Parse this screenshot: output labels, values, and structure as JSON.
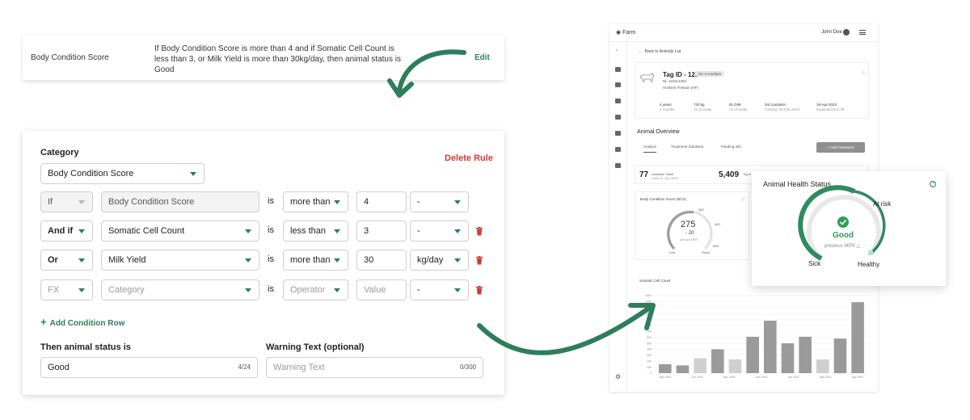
{
  "summary_rule": {
    "label": "Body Condition Score",
    "text": "If Body Condition Score is more than 4 and if Somatic Cell Count is less than 3, or Milk Yield is more than 30kg/day, then animal status is Good",
    "edit_label": "Edit"
  },
  "editor": {
    "category_label": "Category",
    "category_value": "Body Condition Score",
    "delete_label": "Delete Rule",
    "is_label": "is",
    "rows": [
      {
        "connector": "If",
        "field": "Body Condition Score",
        "operator": "more than",
        "value": "4",
        "unit": "-"
      },
      {
        "connector": "And if",
        "field": "Somatic Cell Count",
        "operator": "less than",
        "value": "3",
        "unit": "-"
      },
      {
        "connector": "Or",
        "field": "Milk Yield",
        "operator": "more than",
        "value": "30",
        "unit": "kg/day"
      },
      {
        "connector": "FX",
        "field": "Category",
        "operator": "Operator",
        "value": "Value",
        "unit": "-"
      }
    ],
    "add_condition_label": "Add Condition Row",
    "status_label": "Then animal status is",
    "status_value": "Good",
    "status_count": "4/24",
    "warning_label": "Warning Text (optional)",
    "warning_placeholder": "Warning Text",
    "warning_count": "0/300"
  },
  "dashboard": {
    "logo": "Farm",
    "user": "John Doe",
    "avatar_initial": "C",
    "back_link": "Back to Animals List",
    "tag_title": "Tag ID - 1234",
    "tag_badge": "DC-2-medium",
    "tag_number": "NL 123114284",
    "breed": "Holstein Friesian (HF)",
    "stats": [
      {
        "top": "4 years",
        "bottom": "2 months"
      },
      {
        "top": "720 kg",
        "bottom": "As of today"
      },
      {
        "top": "91 DIM",
        "bottom": "As of today"
      },
      {
        "top": "3rd Lactation",
        "bottom": "Calving: 09-Feb-2023"
      },
      {
        "top": "18-Apr-2023",
        "bottom": "Expected Dry Off"
      }
    ],
    "overview_title": "Animal Overview",
    "tabs": [
      "Analyze",
      "Treatment Solutions",
      "Feeding Info"
    ],
    "add_treatment": "+ Add Treatment",
    "kpi1_value": "77",
    "kpi1_label": "Lactation Value",
    "kpi1_sub": "Units 01-Jan-2023",
    "kpi2_value": "5,409",
    "kpi2_label": "Kg m",
    "bcs_title": "Body Condition Score (BCS)",
    "bcs_value": "275",
    "bcs_delta": "- 20",
    "bcs_sub": "previous MPR",
    "bcs_ticks": [
      "300",
      "400",
      "600"
    ],
    "bcs_low": "Low",
    "bcs_good": "Good",
    "scc_title": "Somatic Cell Count"
  },
  "chart_data": {
    "type": "bar",
    "title": "Somatic Cell Count",
    "xlabel": "",
    "ylabel": "",
    "x_tick_labels": [
      "Sep 2020",
      "Oct 2020",
      "Nov 2020",
      "Dec 2020",
      "Jan 2021",
      "Mar 2021",
      "Apr 2021"
    ],
    "y_tick_labels": [
      "0",
      "100",
      "200",
      "300",
      "400",
      "500",
      "600",
      "700",
      "800",
      "900",
      "1000",
      "1100",
      "1200",
      "1300"
    ],
    "ylim": [
      0,
      1300
    ],
    "values": [
      150,
      130,
      250,
      400,
      230,
      610,
      880,
      500,
      610,
      230,
      580,
      1190
    ],
    "bar_colors": [
      "#9a9a9a",
      "#9a9a9a",
      "#cfcfcf",
      "#9a9a9a",
      "#cfcfcf",
      "#9a9a9a",
      "#9a9a9a",
      "#9a9a9a",
      "#9a9a9a",
      "#cfcfcf",
      "#9a9a9a",
      "#9a9a9a"
    ],
    "grid": true
  },
  "health": {
    "title": "Animal Health Status",
    "help": "?",
    "status": "Good",
    "previous": "previous MPR",
    "label_at_risk": "At risk",
    "label_sick": "Sick",
    "label_healthy": "Healthy"
  },
  "colors": {
    "accent": "#2e7d5b",
    "danger": "#d03a3a",
    "good": "#2e9e58"
  }
}
